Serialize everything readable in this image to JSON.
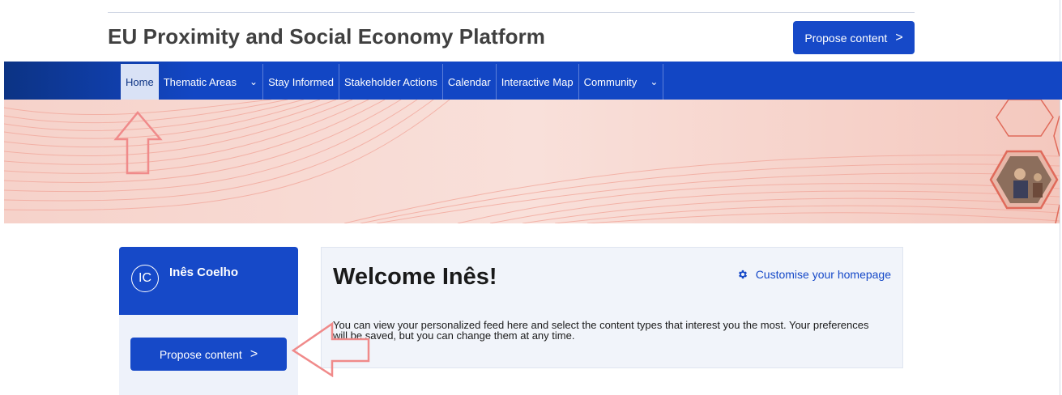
{
  "header": {
    "site_title": "EU Proximity and Social Economy Platform",
    "propose_button_label": "Propose content",
    "propose_button_chevron": ">"
  },
  "nav": {
    "items": [
      {
        "label": "Home",
        "active": true,
        "has_dropdown": false
      },
      {
        "label": "Thematic Areas",
        "active": false,
        "has_dropdown": true
      },
      {
        "label": "Stay Informed",
        "active": false,
        "has_dropdown": false
      },
      {
        "label": "Stakeholder Actions",
        "active": false,
        "has_dropdown": false
      },
      {
        "label": "Calendar",
        "active": false,
        "has_dropdown": false
      },
      {
        "label": "Interactive Map",
        "active": false,
        "has_dropdown": false
      },
      {
        "label": "Community",
        "active": false,
        "has_dropdown": true
      }
    ],
    "dropdown_glyph": "⌄"
  },
  "sidebar": {
    "avatar_initials": "IC",
    "user_name": "Inês Coelho",
    "propose_button_label": "Propose content",
    "propose_button_chevron": ">"
  },
  "welcome": {
    "title": "Welcome Inês!",
    "customise_label": "Customise your homepage",
    "customise_icon": "gear-icon",
    "body_text": "You can view your personalized feed here and select the content types that interest you the most. Your preferences will be saved, but you can change them at any time."
  },
  "colors": {
    "brand_blue": "#1649c8",
    "nav_dark": "#0c3384",
    "banner_pink": "#f7d8d0",
    "annotation_arrow": "#f08a8a"
  }
}
